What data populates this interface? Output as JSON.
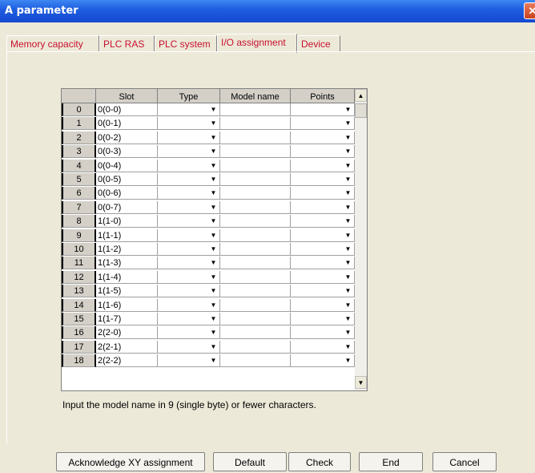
{
  "window": {
    "title": "A parameter",
    "close_label": "✕"
  },
  "tabs": [
    {
      "label": "Memory capacity"
    },
    {
      "label": "PLC RAS"
    },
    {
      "label": "PLC system"
    },
    {
      "label": "I/O assignment",
      "active": true
    },
    {
      "label": "Device"
    }
  ],
  "grid": {
    "columns": [
      "",
      "Slot",
      "Type",
      "Model name",
      "Points"
    ],
    "rows": [
      {
        "num": "0",
        "slot": "0(0-0)"
      },
      {
        "num": "1",
        "slot": "0(0-1)"
      },
      {
        "num": "2",
        "slot": "0(0-2)"
      },
      {
        "num": "3",
        "slot": "0(0-3)"
      },
      {
        "num": "4",
        "slot": "0(0-4)"
      },
      {
        "num": "5",
        "slot": "0(0-5)"
      },
      {
        "num": "6",
        "slot": "0(0-6)"
      },
      {
        "num": "7",
        "slot": "0(0-7)"
      },
      {
        "num": "8",
        "slot": "1(1-0)"
      },
      {
        "num": "9",
        "slot": "1(1-1)"
      },
      {
        "num": "10",
        "slot": "1(1-2)"
      },
      {
        "num": "11",
        "slot": "1(1-3)"
      },
      {
        "num": "12",
        "slot": "1(1-4)"
      },
      {
        "num": "13",
        "slot": "1(1-5)"
      },
      {
        "num": "14",
        "slot": "1(1-6)"
      },
      {
        "num": "15",
        "slot": "1(1-7)"
      },
      {
        "num": "16",
        "slot": "2(2-0)"
      },
      {
        "num": "17",
        "slot": "2(2-1)"
      },
      {
        "num": "18",
        "slot": "2(2-2)"
      }
    ],
    "dropdown_icon": "▼",
    "scroll_up_icon": "▲",
    "scroll_down_icon": "▼"
  },
  "hint": "Input the model name in 9 (single byte) or fewer characters.",
  "buttons": {
    "acknowledge": "Acknowledge XY assignment",
    "default": "Default",
    "check": "Check",
    "end": "End",
    "cancel": "Cancel"
  },
  "colors": {
    "title_bar": "#1f5fe0",
    "tab_text": "#c8102e",
    "dialog_bg": "#ece9d8"
  }
}
